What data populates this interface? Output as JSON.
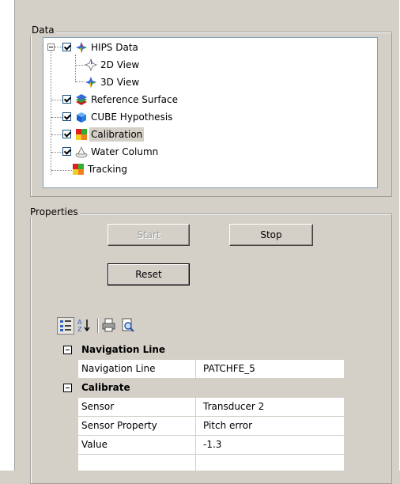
{
  "data_group": {
    "legend": "Data",
    "tree": [
      {
        "label": "HIPS Data",
        "checked": true,
        "icon": "hips-data-icon"
      },
      {
        "label": "2D View",
        "checked": false,
        "icon": "view-2d-icon"
      },
      {
        "label": "3D View",
        "checked": false,
        "icon": "view-3d-icon"
      },
      {
        "label": "Reference Surface",
        "checked": true,
        "icon": "reference-surface-icon"
      },
      {
        "label": "CUBE Hypothesis",
        "checked": true,
        "icon": "cube-icon"
      },
      {
        "label": "Calibration",
        "checked": true,
        "icon": "calibration-icon",
        "selected": true
      },
      {
        "label": "Water Column",
        "checked": true,
        "icon": "water-column-icon"
      },
      {
        "label": "Tracking",
        "checked": false,
        "icon": "tracking-icon"
      }
    ]
  },
  "properties_group": {
    "legend": "Properties",
    "start_label": "Start",
    "stop_label": "Stop",
    "reset_label": "Reset"
  },
  "property_grid": {
    "categories": [
      {
        "name": "Navigation Line",
        "rows": [
          {
            "name": "Navigation Line",
            "value": "PATCHFE_5"
          }
        ]
      },
      {
        "name": "Calibrate",
        "rows": [
          {
            "name": "Sensor",
            "value": "Transducer 2"
          },
          {
            "name": "Sensor Property",
            "value": "Pitch error"
          },
          {
            "name": "Value",
            "value": "-1.3"
          }
        ]
      }
    ]
  },
  "colors": {
    "window_bg": "#d4d0c8",
    "selection_bg": "#d4d0c8",
    "grid_category_bg": "#d4d0c8"
  }
}
